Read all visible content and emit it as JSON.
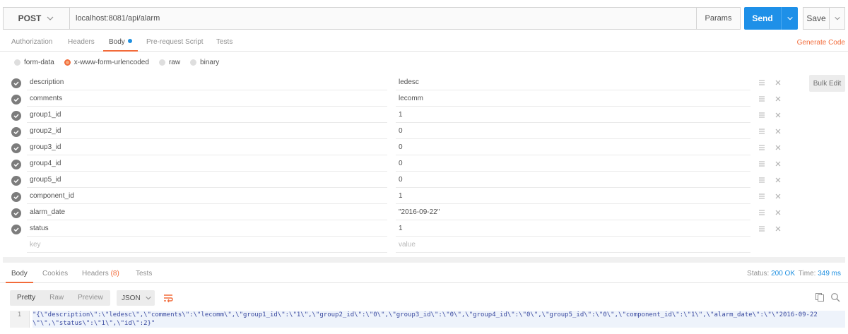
{
  "request": {
    "method": "POST",
    "url": "localhost:8081/api/alarm",
    "params_label": "Params",
    "send_label": "Send",
    "save_label": "Save"
  },
  "request_tabs": [
    {
      "label": "Authorization"
    },
    {
      "label": "Headers"
    },
    {
      "label": "Body"
    },
    {
      "label": "Pre-request Script"
    },
    {
      "label": "Tests"
    }
  ],
  "active_request_tab": "Body",
  "generate_code_label": "Generate Code",
  "body_modes": [
    {
      "label": "form-data",
      "selected": false
    },
    {
      "label": "x-www-form-urlencoded",
      "selected": true
    },
    {
      "label": "raw",
      "selected": false
    },
    {
      "label": "binary",
      "selected": false
    }
  ],
  "bulk_edit_label": "Bulk Edit",
  "params": [
    {
      "key": "description",
      "value": "ledesc"
    },
    {
      "key": "comments",
      "value": "lecomm"
    },
    {
      "key": "group1_id",
      "value": "1"
    },
    {
      "key": "group2_id",
      "value": "0"
    },
    {
      "key": "group3_id",
      "value": "0"
    },
    {
      "key": "group4_id",
      "value": "0"
    },
    {
      "key": "group5_id",
      "value": "0"
    },
    {
      "key": "component_id",
      "value": "1"
    },
    {
      "key": "alarm_date",
      "value": "\"2016-09-22\""
    },
    {
      "key": "status",
      "value": "1"
    }
  ],
  "new_row": {
    "key_placeholder": "key",
    "value_placeholder": "value"
  },
  "response_tabs": [
    {
      "label": "Body"
    },
    {
      "label": "Cookies"
    },
    {
      "label": "Headers",
      "count": "(8)"
    },
    {
      "label": "Tests"
    }
  ],
  "response_status": {
    "status_label": "Status:",
    "status_value": "200 OK",
    "time_label": "Time:",
    "time_value": "349 ms"
  },
  "format_buttons": [
    {
      "label": "Pretty",
      "active": true
    },
    {
      "label": "Raw",
      "active": false
    },
    {
      "label": "Preview",
      "active": false
    }
  ],
  "language": "JSON",
  "response_body": {
    "line_number": "1",
    "text": "\"{\\\"description\\\":\\\"ledesc\\\",\\\"comments\\\":\\\"lecomm\\\",\\\"group1_id\\\":\\\"1\\\",\\\"group2_id\\\":\\\"0\\\",\\\"group3_id\\\":\\\"0\\\",\\\"group4_id\\\":\\\"0\\\",\\\"group5_id\\\":\\\"0\\\",\\\"component_id\\\":\\\"1\\\",\\\"alarm_date\\\":\\\"\\\"2016-09-22\\\"\\\",\\\"status\\\":\\\"1\\\",\\\"id\\\":2}\""
  },
  "colors": {
    "accent": "#f26b3a",
    "send_blue": "#1e90e8",
    "status_ok": "#1e8fe0"
  },
  "icons": [
    "chevron-down-icon",
    "check-circle-icon",
    "drag-handle-icon",
    "close-icon",
    "wrap-lines-icon",
    "copy-icon",
    "search-icon"
  ]
}
